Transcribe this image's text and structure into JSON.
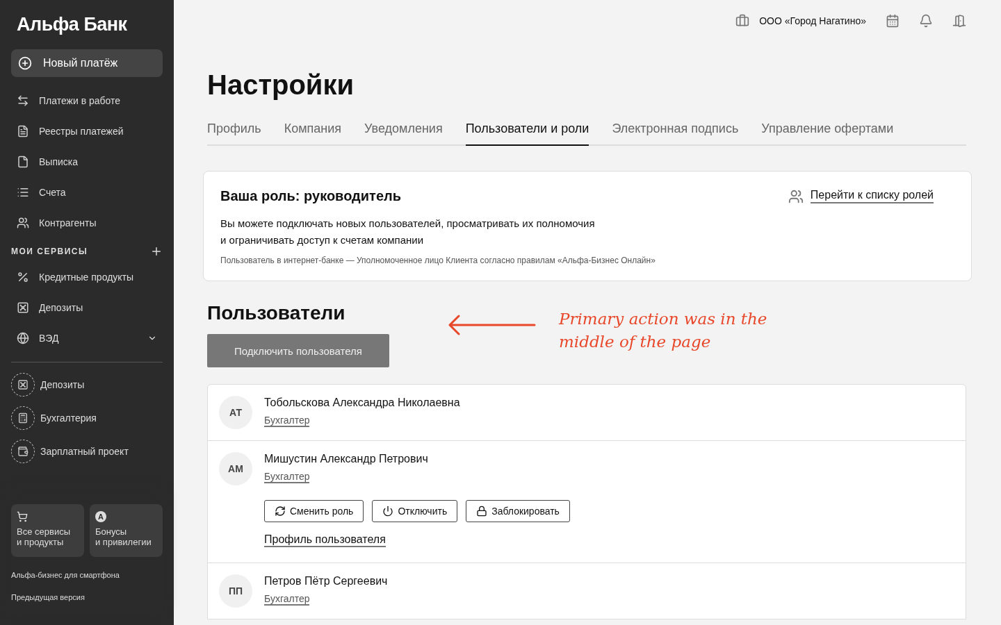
{
  "sidebar": {
    "logo": "Альфа Банк",
    "new_payment": "Новый платёж",
    "items": [
      {
        "label": "Платежи в работе"
      },
      {
        "label": "Реестры платежей"
      },
      {
        "label": "Выписка"
      },
      {
        "label": "Счета"
      },
      {
        "label": "Контрагенты"
      }
    ],
    "services_heading": "МОИ СЕРВИСЫ",
    "services": [
      {
        "label": "Кредитные продукты",
        "expandable": false
      },
      {
        "label": "Депозиты",
        "expandable": false
      },
      {
        "label": "ВЭД",
        "expandable": true
      }
    ],
    "suggested": [
      {
        "label": "Депозиты"
      },
      {
        "label": "Бухгалтерия"
      },
      {
        "label": "Зарплатный проект"
      }
    ],
    "tiles": [
      {
        "kind": "icon",
        "label": "Все сервисы\nи продукты"
      },
      {
        "kind": "letter",
        "glyph": "A",
        "label": "Бонусы\nи привилегии"
      }
    ],
    "footer_links": [
      "Альфа-бизнес для смартфона",
      "Предыдущая версия"
    ]
  },
  "header": {
    "company": "ООО «Город Нагатино»"
  },
  "page_title": "Настройки",
  "tabs": [
    {
      "label": "Профиль",
      "selected": false
    },
    {
      "label": "Компания",
      "selected": false
    },
    {
      "label": "Уведомления",
      "selected": false
    },
    {
      "label": "Пользователи и роли",
      "selected": true
    },
    {
      "label": "Электронная подпись",
      "selected": false
    },
    {
      "label": "Управление офертами",
      "selected": false
    }
  ],
  "role_card": {
    "title": "Ваша роль: руководитель",
    "link": "Перейти к списку ролей",
    "description": "Вы можете подключать новых пользователей, просматривать их полномочия\nи ограничивать доступ к счетам компании",
    "note": "Пользователь в интернет-банке — Уполномоченное лицо Клиента согласно правилам «Альфа-Бизнес Онлайн»"
  },
  "users_section": {
    "title": "Пользователи",
    "add_button": "Подключить пользователя",
    "annotation": "Primary action was in the\nmiddle of the page",
    "users": [
      {
        "initials": "АТ",
        "name": "Тобольскова Александра Николаевна",
        "role": "Бухгалтер",
        "expanded": false
      },
      {
        "initials": "АМ",
        "name": "Мишустин Александр Петрович",
        "role": "Бухгалтер",
        "expanded": true,
        "actions": [
          "Сменить роль",
          "Отключить",
          "Заблокировать"
        ],
        "profile_link": "Профиль пользователя"
      },
      {
        "initials": "ПП",
        "name": "Петров Пётр Сергеевич",
        "role": "Бухгалтер",
        "expanded": false
      }
    ]
  }
}
